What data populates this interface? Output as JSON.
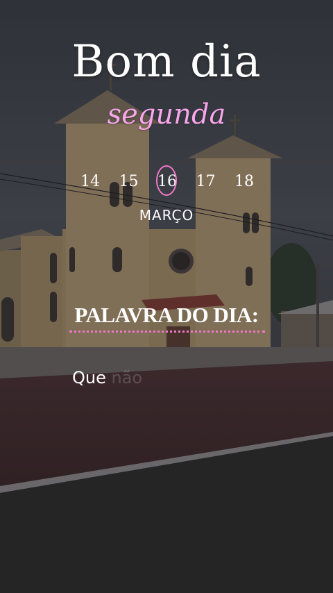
{
  "greeting": {
    "title": "Bom dia",
    "weekday": "segunda"
  },
  "calendar": {
    "days": [
      "14",
      "15",
      "16",
      "17",
      "18"
    ],
    "highlighted_day": "16",
    "month": "MARÇO"
  },
  "word_of_day": {
    "heading": "PALAVRA DO DIA:",
    "text_start": "Que",
    "text_faded": " não"
  },
  "colors": {
    "accent_pink": "#f178c9",
    "text_white": "#ffffff"
  }
}
